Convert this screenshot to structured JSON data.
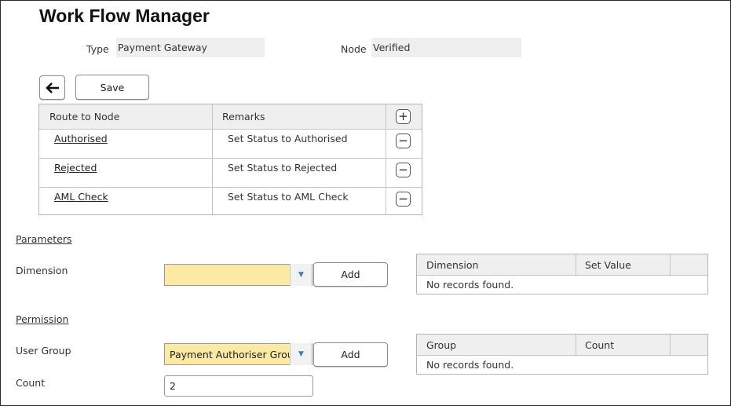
{
  "title": "Work Flow Manager",
  "type": {
    "label": "Type",
    "value": "Payment Gateway"
  },
  "node": {
    "label": "Node",
    "value": "Verified"
  },
  "toolbar": {
    "back_icon": "arrow-left-icon",
    "save_label": "Save"
  },
  "routes": {
    "headers": {
      "route": "Route to Node",
      "remarks": "Remarks"
    },
    "add_icon": "plus-icon",
    "remove_icon": "minus-icon",
    "rows": [
      {
        "route": "Authorised",
        "remarks": "Set Status to Authorised"
      },
      {
        "route": "Rejected",
        "remarks": "Set Status to Rejected"
      },
      {
        "route": "AML Check",
        "remarks": "Set Status to AML Check"
      }
    ]
  },
  "parameters": {
    "section_label": "Parameters",
    "dimension_label": "Dimension",
    "dimension_value": "",
    "add_label": "Add",
    "table": {
      "col1": "Dimension",
      "col2": "Set Value",
      "empty": "No records found."
    }
  },
  "permission": {
    "section_label": "Permission",
    "user_group_label": "User Group",
    "user_group_value": "Payment Authoriser Group",
    "add_label": "Add",
    "count_label": "Count",
    "count_value": "2",
    "table": {
      "col1": "Group",
      "col2": "Count",
      "empty": "No records found."
    }
  },
  "colors": {
    "dropdown_bg": "#fbe9a4",
    "readonly_bg": "#efefef",
    "header_bg": "#efefef",
    "dropdown_arrow": "#3d7fb6"
  }
}
